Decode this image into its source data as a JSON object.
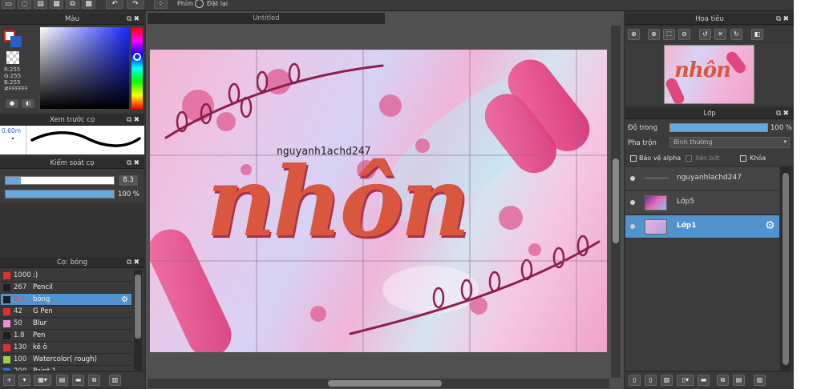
{
  "toolbar": {
    "key_label": "Phím",
    "reset_label": "Đặt lại"
  },
  "color_panel": {
    "title": "Màu",
    "r": "R:255",
    "g": "G:255",
    "b": "B:255",
    "hex": "#FFFFFF"
  },
  "brush_preview": {
    "title": "Xem trước cọ",
    "size": "0.60m"
  },
  "brush_control": {
    "title": "Kiểm soát cọ",
    "size_value": "8.3",
    "size_fraction": 0.14,
    "opacity_label": "100 %",
    "opacity_fraction": 1.0
  },
  "brush_list": {
    "title": "Cọ: bóng",
    "items": [
      {
        "size": "1000",
        "name": ":)",
        "color": "#e03030"
      },
      {
        "size": "267",
        "name": "Pencil",
        "color": "#1e1e1e"
      },
      {
        "size": "8.3",
        "name": "bóng",
        "color": "#1e1e1e",
        "selected": true
      },
      {
        "size": "42",
        "name": "G Pen",
        "color": "#e03030"
      },
      {
        "size": "50",
        "name": "Blur",
        "color": "#f08fd8"
      },
      {
        "size": "1.8",
        "name": "Pen",
        "color": "#1e1e1e"
      },
      {
        "size": "130",
        "name": "kê ô",
        "color": "#e03030"
      },
      {
        "size": "100",
        "name": "Watercolor( rough)",
        "color": "#9ad04e"
      },
      {
        "size": "200",
        "name": "Paint 1",
        "color": "#2e6fd6"
      }
    ]
  },
  "canvas": {
    "tab_title": "Untitled",
    "watermark": "nguyanh1achd247",
    "headline": "nhôn"
  },
  "navigator": {
    "title": "Hoa tiêu"
  },
  "layers_panel": {
    "title": "Lớp",
    "opacity_label": "Độ trong",
    "opacity_value": "100 %",
    "blend_label": "Pha trộn",
    "blend_value": "Bình thường",
    "protect_alpha": "Bảo vệ alpha",
    "clip": "Xén bớt",
    "lock": "Khóa",
    "layers": [
      {
        "name": "nguyanhlachd247",
        "type": "text"
      },
      {
        "name": "Lớp5",
        "type": "image"
      },
      {
        "name": "Lớp1",
        "type": "image",
        "selected": true
      }
    ]
  },
  "colors": {
    "accent": "#4f93cf",
    "panel": "#3c3c3c",
    "canvas_pink": "#e87ab3"
  }
}
